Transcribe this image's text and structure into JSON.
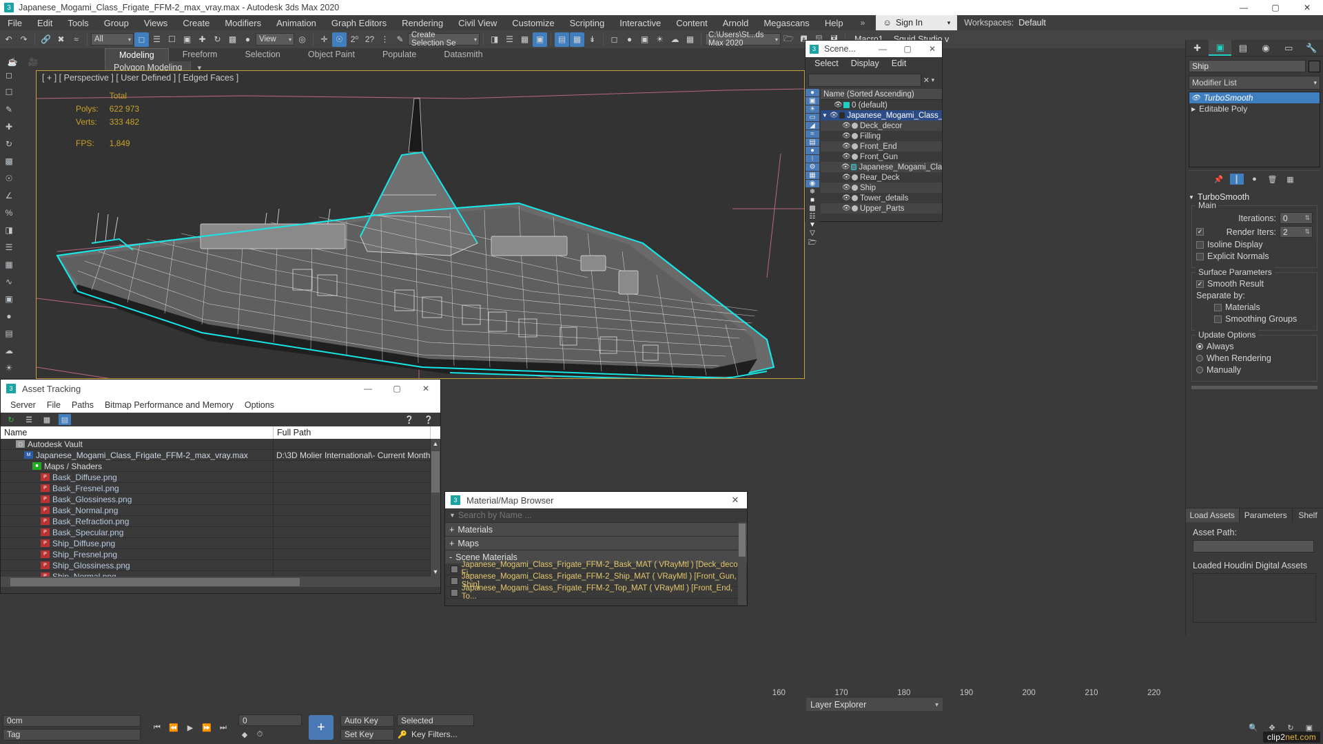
{
  "titlebar": {
    "app_icon": "3dsmax-logo-icon",
    "title": "Japanese_Mogami_Class_Frigate_FFM-2_max_vray.max - Autodesk 3ds Max 2020",
    "minimize": "—",
    "maximize": "▢",
    "close": "✕"
  },
  "menubar": {
    "items": [
      "File",
      "Edit",
      "Tools",
      "Group",
      "Views",
      "Create",
      "Modifiers",
      "Animation",
      "Graph Editors",
      "Rendering",
      "Civil View",
      "Customize",
      "Scripting",
      "Interactive",
      "Content",
      "Arnold",
      "Megascans",
      "Help"
    ],
    "overflow": "»",
    "signin": "Sign In",
    "workspaces_label": "Workspaces:",
    "workspaces_value": "Default"
  },
  "toolbar": {
    "selection_filter": "All",
    "ref_coord": "View",
    "selection_set": "Create Selection Se",
    "project_path": "C:\\Users\\St...ds Max 2020",
    "macro": "Macro1",
    "studio": "Squid Studio v",
    "undo": "undo-icon",
    "redo": "redo-icon"
  },
  "ribbon": {
    "tabs": [
      "Modeling",
      "Freeform",
      "Selection",
      "Object Paint",
      "Populate",
      "Datasmith"
    ],
    "active_tab": "Modeling",
    "panel_label": "Polygon Modeling"
  },
  "viewport": {
    "label": "[ + ] [ Perspective ] [ User Defined ] [ Edged Faces ]",
    "stats": {
      "total_header": "Total",
      "polys_label": "Polys:",
      "polys_value": "622 973",
      "verts_label": "Verts:",
      "verts_value": "333 482",
      "fps_label": "FPS:",
      "fps_value": "1,849"
    },
    "stats_color": "#c9a227",
    "selection_highlight_color": "#19e6e6",
    "border_color": "#c8a13c"
  },
  "scene_explorer": {
    "title": "Scene...",
    "window_buttons": [
      "—",
      "▢",
      "✕"
    ],
    "menu": [
      "Select",
      "Display",
      "Edit"
    ],
    "search_value": "",
    "clear_button": "✕",
    "column_header": "Name (Sorted Ascending)",
    "side_icons": [
      "all-objects-icon",
      "geometry-icon",
      "lights-icon",
      "cameras-icon",
      "helpers-icon",
      "space-warps-icon",
      "groups-icon",
      "xrefs-icon",
      "particles-icon",
      "bones-icon",
      "layers-icon",
      "materials-icon",
      "freeze-icon",
      "hide-icon",
      "display-icon",
      "containers-icon",
      "filter-icon",
      "funnel-icon",
      "folder-icon"
    ],
    "rows": [
      {
        "name": "0 (default)",
        "indent": 1,
        "type": "layer",
        "selected": false
      },
      {
        "name": "Japanese_Mogami_Class_F",
        "indent": 1,
        "type": "layer",
        "selected": true,
        "expanded": true
      },
      {
        "name": "Deck_decor",
        "indent": 2,
        "type": "object",
        "selected": false
      },
      {
        "name": "Filling",
        "indent": 2,
        "type": "object",
        "selected": false
      },
      {
        "name": "Front_End",
        "indent": 2,
        "type": "object",
        "selected": false
      },
      {
        "name": "Front_Gun",
        "indent": 2,
        "type": "object",
        "selected": false
      },
      {
        "name": "Japanese_Mogami_Clas",
        "indent": 2,
        "type": "xref",
        "selected": false
      },
      {
        "name": "Rear_Deck",
        "indent": 2,
        "type": "object",
        "selected": false
      },
      {
        "name": "Ship",
        "indent": 2,
        "type": "object",
        "selected": false,
        "highlighted": true
      },
      {
        "name": "Tower_details",
        "indent": 2,
        "type": "object",
        "selected": false
      },
      {
        "name": "Upper_Parts",
        "indent": 2,
        "type": "object",
        "selected": false
      }
    ]
  },
  "command_panel": {
    "tabs": [
      "create-tab",
      "modify-tab",
      "hierarchy-tab",
      "motion-tab",
      "display-tab",
      "utilities-tab"
    ],
    "active_tab_index": 1,
    "object_name": "Ship",
    "modifier_list_label": "Modifier List",
    "stack": [
      {
        "label": "TurboSmooth",
        "selected": true,
        "eye": true
      },
      {
        "label": "Editable Poly",
        "selected": false,
        "expandable": true
      }
    ],
    "stack_buttons": [
      "pin-stack-icon",
      "show-end-result-icon",
      "make-unique-icon",
      "remove-modifier-icon",
      "configure-sets-icon"
    ],
    "rollout": {
      "title": "TurboSmooth",
      "main_group": "Main",
      "iterations_label": "Iterations:",
      "iterations_value": "0",
      "render_iters_label": "Render Iters:",
      "render_iters_value": "2",
      "render_iters_checked": true,
      "isoline_display": "Isoline Display",
      "isoline_checked": false,
      "explicit_normals": "Explicit Normals",
      "explicit_checked": false,
      "surface_group": "Surface Parameters",
      "smooth_result": "Smooth Result",
      "smooth_checked": true,
      "separate_by": "Separate by:",
      "materials": "Materials",
      "materials_checked": false,
      "smoothing_groups": "Smoothing Groups",
      "smoothing_checked": false,
      "update_group": "Update Options",
      "update_always": "Always",
      "update_when_rendering": "When Rendering",
      "update_manually": "Manually",
      "update_selected": "Always"
    },
    "bottom_tabs": [
      "Load Assets",
      "Parameters",
      "Shelf"
    ],
    "asset_path_label": "Asset Path:",
    "asset_path_value": "",
    "loaded_houdini_label": "Loaded Houdini Digital Assets"
  },
  "asset_tracking": {
    "title": "Asset Tracking",
    "window_buttons": [
      "—",
      "▢",
      "✕"
    ],
    "menu": [
      "Server",
      "File",
      "Paths",
      "Bitmap Performance and Memory",
      "Options"
    ],
    "toolbar_icons": [
      "refresh-icon",
      "list-view-icon",
      "thumbnail-view-icon",
      "grid-view-icon"
    ],
    "help_icons": [
      "help-icon",
      "context-help-icon"
    ],
    "columns": [
      "Name",
      "Full Path"
    ],
    "rows": [
      {
        "name": "Autodesk Vault",
        "indent": 1,
        "icon": "vault",
        "path": ""
      },
      {
        "name": "Japanese_Mogami_Class_Frigate_FFM-2_max_vray.max",
        "indent": 2,
        "icon": "max",
        "path": "D:\\3D Molier International\\- Current Month"
      },
      {
        "name": "Maps / Shaders",
        "indent": 3,
        "icon": "maps",
        "path": ""
      },
      {
        "name": "Bask_Diffuse.png",
        "indent": 4,
        "icon": "png",
        "path": ""
      },
      {
        "name": "Bask_Fresnel.png",
        "indent": 4,
        "icon": "png",
        "path": ""
      },
      {
        "name": "Bask_Glossiness.png",
        "indent": 4,
        "icon": "png",
        "path": ""
      },
      {
        "name": "Bask_Normal.png",
        "indent": 4,
        "icon": "png",
        "path": ""
      },
      {
        "name": "Bask_Refraction.png",
        "indent": 4,
        "icon": "png",
        "path": ""
      },
      {
        "name": "Bask_Specular.png",
        "indent": 4,
        "icon": "png",
        "path": ""
      },
      {
        "name": "Ship_Diffuse.png",
        "indent": 4,
        "icon": "png",
        "path": ""
      },
      {
        "name": "Ship_Fresnel.png",
        "indent": 4,
        "icon": "png",
        "path": ""
      },
      {
        "name": "Ship_Glossiness.png",
        "indent": 4,
        "icon": "png",
        "path": ""
      },
      {
        "name": "Ship_Normal.png",
        "indent": 4,
        "icon": "png",
        "path": ""
      }
    ]
  },
  "material_browser": {
    "title": "Material/Map Browser",
    "close": "✕",
    "search_placeholder": "Search by Name ...",
    "search_value": "",
    "groups": [
      {
        "label": "Materials",
        "expanded": false,
        "sign": "+"
      },
      {
        "label": "Maps",
        "expanded": false,
        "sign": "+"
      },
      {
        "label": "Scene Materials",
        "expanded": true,
        "sign": "-"
      }
    ],
    "scene_materials": [
      "Japanese_Mogami_Class_Frigate_FFM-2_Bask_MAT ( VRayMtl ) [Deck_decor, Fi...",
      "Japanese_Mogami_Class_Frigate_FFM-2_Ship_MAT ( VRayMtl ) [Front_Gun, Ship]",
      "Japanese_Mogami_Class_Frigate_FFM-2_Top_MAT ( VRayMtl ) [Front_End, To..."
    ]
  },
  "statusbar": {
    "track_ticks": [
      "160",
      "170",
      "180",
      "190",
      "200",
      "210",
      "220"
    ],
    "layer_explorer": "Layer Explorer",
    "coord_label": "0cm",
    "auto_key": "Auto Key",
    "set_key": "Set Key",
    "selected_dropdown": "Selected",
    "key_filters": "Key Filters...",
    "tag_label": "Tag",
    "frame_value": "0",
    "playback_icons": [
      "go-to-start-icon",
      "previous-frame-icon",
      "play-icon",
      "next-frame-icon",
      "go-to-end-icon"
    ],
    "nav_icons": [
      "zoom-icon",
      "pan-icon",
      "orbit-icon",
      "maximize-viewport-icon"
    ],
    "watermark_1": "clip2",
    "watermark_2": "net.com"
  },
  "left_toolbar": {
    "icons": [
      "select-object-icon",
      "select-region-icon",
      "paint-select-icon",
      "move-icon",
      "rotate-icon",
      "scale-icon",
      "snap-icon",
      "angle-snap-icon",
      "percent-snap-icon",
      "mirror-icon",
      "align-icon",
      "layer-manager-icon",
      "curve-editor-icon",
      "schematic-view-icon",
      "material-editor-icon",
      "render-setup-icon",
      "render-frame-icon",
      "render-icon",
      "scene-converter-icon",
      "asset-tracking-icon",
      "help-icon"
    ]
  },
  "colors": {
    "accent_blue": "#3f7fbf",
    "teal": "#1fd1c5",
    "stats_yellow": "#c9a227",
    "panel_bg": "#3a3a3a",
    "toolbar_bg": "#444444",
    "selection_cyan": "#19e6e6",
    "grid_pink": "#d4708f"
  }
}
